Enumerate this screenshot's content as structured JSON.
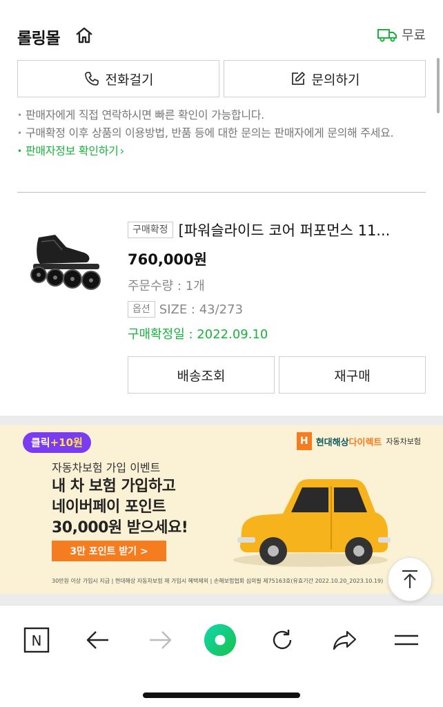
{
  "seller": {
    "name": "롤링몰",
    "shipping_label": "무료"
  },
  "contact": {
    "call_label": "전화걸기",
    "inquiry_label": "문의하기"
  },
  "notes": [
    "판매자에게 직접 연락하시면 빠른 확인이 가능합니다.",
    "구매확정 이후 상품의 이용방법, 반품 등에 대한 문의는 판매자에게 문의해 주세요."
  ],
  "seller_info_link": "판매자정보 확인하기",
  "order": {
    "status_badge": "구매확정",
    "product_title": "[파워슬라이드 코어 퍼포먼스 11...",
    "price": "760,000원",
    "quantity": "주문수량 : 1개",
    "option_badge": "옵션",
    "option_value": "SIZE : 43/273",
    "confirm_date": "구매확정일 : 2022.09.10",
    "track_button": "배송조회",
    "reorder_button": "재구매"
  },
  "banner": {
    "click_badge_prefix": "클릭",
    "click_badge_amount": "+10원",
    "brand_logo": "H",
    "brand_name_main": "현대해상",
    "brand_name_accent": "다이렉트",
    "brand_sub": "자동차보험",
    "event_sub": "자동차보험 가입 이벤트",
    "headline_1": "내 차 보험 가입하고",
    "headline_2": "네이버페이 포인트",
    "headline_3": "30,000원 받으세요!",
    "cta": "3만 포인트 받기 >",
    "fine_print": "30만원 이상 가입시 지급 | 현대해상 자동차보험 재 가입시 혜택제외 | 손해보험협회 심의필 제75163호(유효기간 2022.10.20_2023.10.19)"
  },
  "toolbar": {
    "naver_label": "N"
  },
  "colors": {
    "green": "#18b33c",
    "banner_bg": "#fbf1d5",
    "purple": "#7a3cf0",
    "orange": "#f57c1f"
  },
  "icons": [
    "home-icon",
    "truck-icon",
    "phone-icon",
    "edit-icon",
    "arrow-up-icon",
    "naver-icon",
    "back-icon",
    "forward-icon",
    "green-dot-icon",
    "refresh-icon",
    "share-icon",
    "menu-icon"
  ]
}
